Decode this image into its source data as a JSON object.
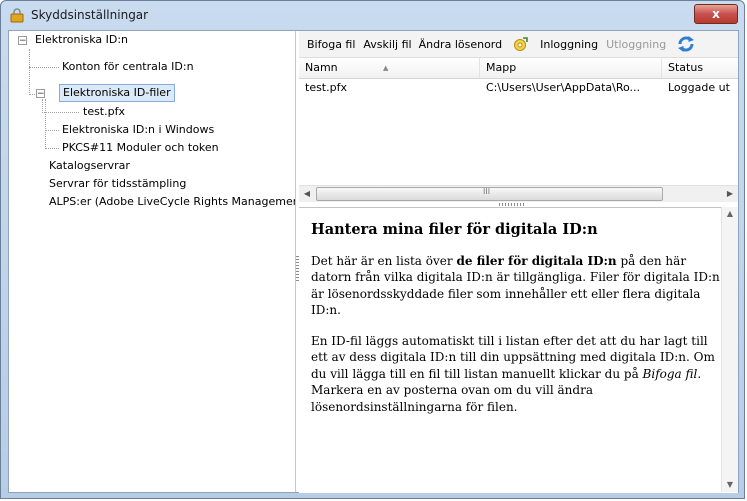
{
  "window": {
    "title": "Skyddsinställningar",
    "close_glyph": "x"
  },
  "tree": {
    "items": [
      {
        "label": "Elektroniska ID:n",
        "expander": "−"
      },
      {
        "label": "Konton för centrala ID:n"
      },
      {
        "label": "Elektroniska ID-filer",
        "expander": "−",
        "selected": true
      },
      {
        "label": "test.pfx"
      },
      {
        "label": "Elektroniska ID:n i Windows"
      },
      {
        "label": "PKCS#11 Moduler och token"
      },
      {
        "label": "Katalogservrar"
      },
      {
        "label": "Servrar för tidsstämpling"
      },
      {
        "label": "ALPS:er (Adobe LiveCycle Rights Management Ser"
      }
    ]
  },
  "toolbar": {
    "attach": "Bifoga fil",
    "detach": "Avskilj fil",
    "change_password": "Ändra lösenord",
    "login": "Inloggning",
    "logout": "Utloggning"
  },
  "table": {
    "columns": [
      "Namn",
      "Mapp",
      "Status"
    ],
    "rows": [
      {
        "name": "test.pfx",
        "folder": "C:\\Users\\User\\AppData\\Ro...",
        "status": "Loggade ut"
      }
    ],
    "hscroll_glyph": "III"
  },
  "help": {
    "title": "Hantera mina filer för digitala ID:n",
    "p1_before": "Det här är en lista över ",
    "p1_bold": "de filer för digitala ID:n",
    "p1_after": " på den här datorn från vilka digitala ID:n är tillgängliga. Filer för digitala ID:n är lösenordsskyddade filer som innehåller ett eller flera digitala ID:n.",
    "p2_before": "En ID-fil läggs automatiskt till i listan efter det att du har lagt till ett av dess digitala ID:n till din uppsättning med digitala ID:n. Om du vill lägga till en fil till listan manuellt klickar du på ",
    "p2_italic": "Bifoga fil",
    "p2_after": ". Markera en av posterna ovan om du vill ändra lösenordsinställningarna för filen."
  },
  "colors": {
    "selection_bg": "#dceaf8",
    "selection_border": "#84acdd",
    "close_red": "#c75050"
  }
}
